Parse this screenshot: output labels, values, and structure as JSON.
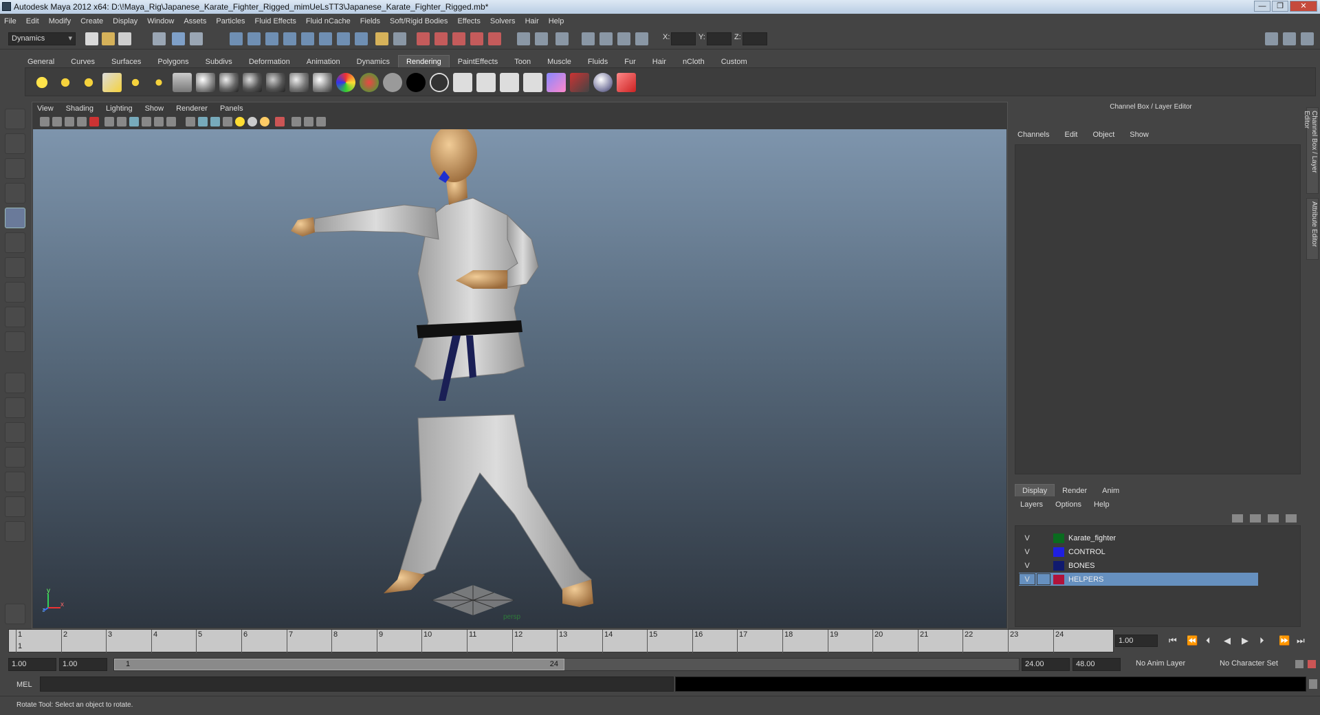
{
  "window": {
    "title": "Autodesk Maya 2012 x64: D:\\!Maya_Rig\\Japanese_Karate_Fighter_Rigged_mimUeLsTT3\\Japanese_Karate_Fighter_Rigged.mb*",
    "buttons": [
      "—",
      "❐",
      "✕"
    ]
  },
  "menubar": [
    "File",
    "Edit",
    "Modify",
    "Create",
    "Display",
    "Window",
    "Assets",
    "Particles",
    "Fluid Effects",
    "Fluid nCache",
    "Fields",
    "Soft/Rigid Bodies",
    "Effects",
    "Solvers",
    "Hair",
    "Help"
  ],
  "statusline": {
    "mode": "Dynamics",
    "x_label": "X:",
    "y_label": "Y:",
    "z_label": "Z:"
  },
  "shelf": {
    "tabs": [
      "General",
      "Curves",
      "Surfaces",
      "Polygons",
      "Subdivs",
      "Deformation",
      "Animation",
      "Dynamics",
      "Rendering",
      "PaintEffects",
      "Toon",
      "Muscle",
      "Fluids",
      "Fur",
      "Hair",
      "nCloth",
      "Custom"
    ],
    "active_tab": "Rendering"
  },
  "viewport": {
    "menu": [
      "View",
      "Shading",
      "Lighting",
      "Show",
      "Renderer",
      "Panels"
    ],
    "camera_label": "persp",
    "axis_y": "y",
    "axis_x": "x",
    "axis_z": "z"
  },
  "channel_box": {
    "title": "Channel Box / Layer Editor",
    "menu": [
      "Channels",
      "Edit",
      "Object",
      "Show"
    ],
    "side_tabs": [
      "Channel Box / Layer Editor",
      "Attribute Editor"
    ]
  },
  "layer_editor": {
    "tabs": [
      "Display",
      "Render",
      "Anim"
    ],
    "active_tab": "Display",
    "menu": [
      "Layers",
      "Options",
      "Help"
    ],
    "layers": [
      {
        "visible": "V",
        "name": "Karate_fighter",
        "color": "#0a6b1f"
      },
      {
        "visible": "V",
        "name": "CONTROL",
        "color": "#1f1fe0"
      },
      {
        "visible": "V",
        "name": "BONES",
        "color": "#101a6e"
      },
      {
        "visible": "V",
        "name": "HELPERS",
        "color": "#b0133a"
      }
    ],
    "selected_layer": "HELPERS"
  },
  "timeline": {
    "ticks": [
      "1",
      "2",
      "3",
      "4",
      "5",
      "6",
      "7",
      "8",
      "9",
      "10",
      "11",
      "12",
      "13",
      "14",
      "15",
      "16",
      "17",
      "18",
      "19",
      "20",
      "21",
      "22",
      "23",
      "24"
    ],
    "current_frame_marker": "1",
    "current_frame": "1.00"
  },
  "range": {
    "start_time": "1.00",
    "start_playback": "1.00",
    "slider_start": "1",
    "slider_end": "24",
    "end_playback": "24.00",
    "end_time": "48.00",
    "anim_layer": "No Anim Layer",
    "character_set": "No Character Set"
  },
  "command": {
    "lang": "MEL"
  },
  "help_line": "Rotate Tool: Select an object to rotate.",
  "colors": {
    "ui_bg": "#444444",
    "selection": "#6690bf",
    "viewport_top": "#7e95ad",
    "viewport_bottom": "#2e3640"
  }
}
